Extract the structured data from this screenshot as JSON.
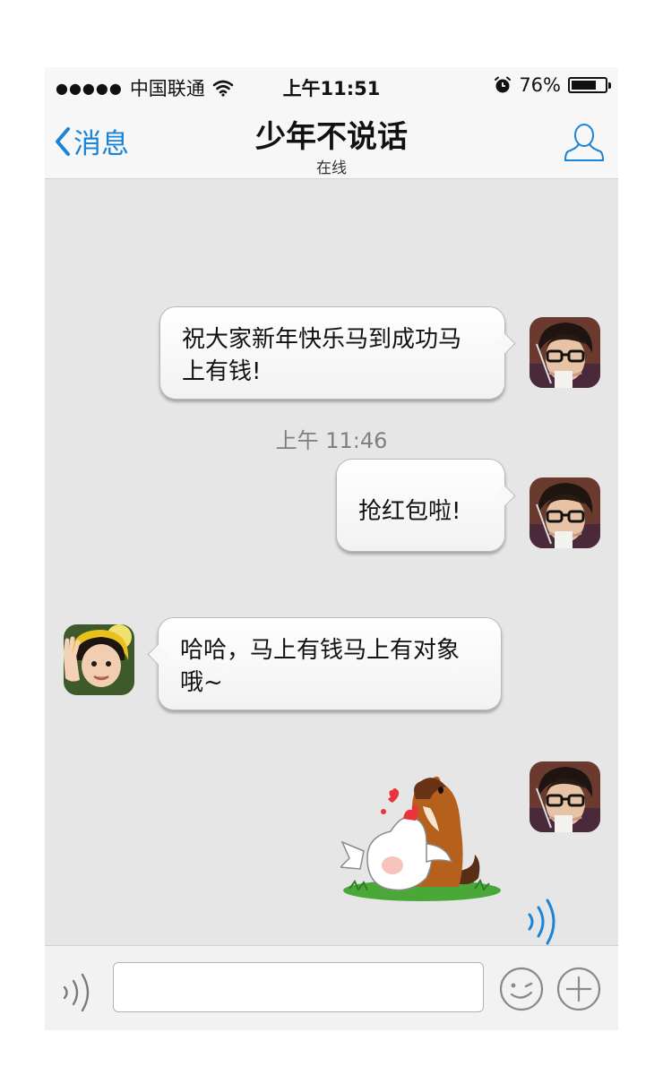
{
  "status_bar": {
    "signal": "●●●●●",
    "carrier": "中国联通",
    "time": "上午11:51",
    "battery_percent": "76%",
    "battery_level": 0.76
  },
  "nav": {
    "back_label": "消息",
    "title": "少年不说话",
    "subtitle": "在线"
  },
  "messages": [
    {
      "side": "out",
      "text": "祝大家新年快乐马到成功马上有钱!"
    },
    {
      "side": "out",
      "text": "抢红包啦!"
    },
    {
      "side": "in",
      "text": "哈哈，马上有钱马上有对象哦~"
    },
    {
      "side": "out",
      "type": "sticker",
      "sticker": "horse-hugging-chicken-sticker"
    }
  ],
  "timestamp": "上午 11:46",
  "input": {
    "value": "",
    "placeholder": ""
  },
  "colors": {
    "accent": "#1a84d8",
    "chat_background": "#e6e6e6",
    "bar_background": "#f7f7f7"
  }
}
